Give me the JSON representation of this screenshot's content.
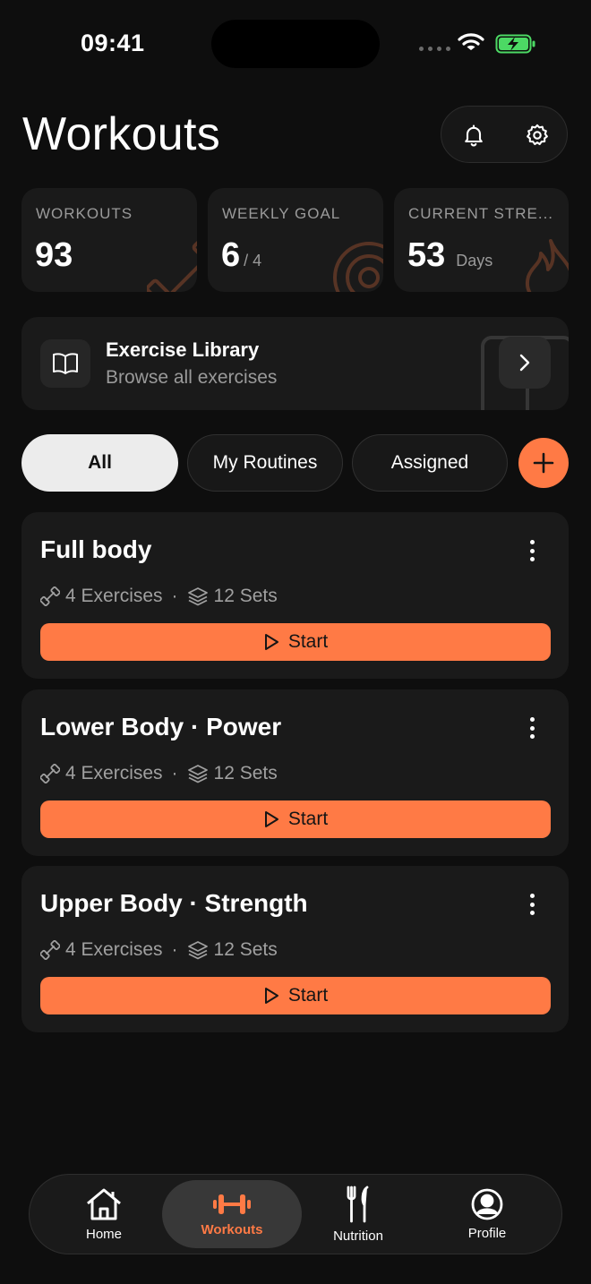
{
  "status_bar": {
    "time": "09:41"
  },
  "header": {
    "title": "Workouts"
  },
  "stats": [
    {
      "label": "WORKOUTS",
      "value": "93",
      "sub": ""
    },
    {
      "label": "WEEKLY GOAL",
      "value": "6",
      "sub": "/ 4"
    },
    {
      "label": "CURRENT STRE...",
      "value": "53",
      "sub": "Days"
    }
  ],
  "library": {
    "title": "Exercise Library",
    "subtitle": "Browse all exercises"
  },
  "filters": [
    {
      "label": "All"
    },
    {
      "label": "My Routines"
    },
    {
      "label": "Assigned"
    }
  ],
  "workouts": [
    {
      "title": "Full body",
      "exercises": "4 Exercises",
      "separator": "·",
      "sets": "12 Sets",
      "start_label": "Start"
    },
    {
      "title": "Lower Body · Power",
      "exercises": "4 Exercises",
      "separator": "·",
      "sets": "12 Sets",
      "start_label": "Start"
    },
    {
      "title": "Upper Body · Strength",
      "exercises": "4 Exercises",
      "separator": "·",
      "sets": "12 Sets",
      "start_label": "Start"
    }
  ],
  "tabs": [
    {
      "label": "Home",
      "icon": "home-icon"
    },
    {
      "label": "Workouts",
      "icon": "dumbbell-icon"
    },
    {
      "label": "Nutrition",
      "icon": "fork-knife-icon"
    },
    {
      "label": "Profile",
      "icon": "profile-icon"
    }
  ],
  "colors": {
    "accent": "#ff7a45",
    "background": "#0e0e0e",
    "card": "#1a1a1a",
    "battery": "#4cd964"
  }
}
